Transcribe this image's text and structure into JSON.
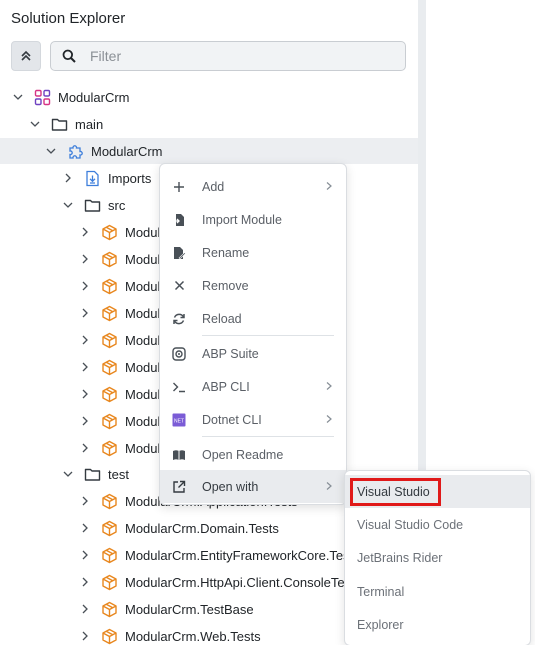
{
  "panel": {
    "title": "Solution Explorer"
  },
  "filter": {
    "placeholder": "Filter"
  },
  "tree": {
    "root": "ModularCrm",
    "main": "main",
    "module": "ModularCrm",
    "imports": "Imports",
    "src": "src",
    "src_items": [
      "Modular",
      "Modular",
      "Modular",
      "Modular",
      "Modular",
      "Modular",
      "Modular",
      "Modular",
      "Modular"
    ],
    "test": "test",
    "test_items": [
      "ModularCrm.Application.Tests",
      "ModularCrm.Domain.Tests",
      "ModularCrm.EntityFrameworkCore.Tests",
      "ModularCrm.HttpApi.Client.ConsoleTestApp",
      "ModularCrm.TestBase",
      "ModularCrm.Web.Tests"
    ]
  },
  "context_menu": {
    "items": [
      {
        "label": "Add",
        "icon": "plus-icon"
      },
      {
        "label": "Import Module",
        "icon": "import-icon"
      },
      {
        "label": "Rename",
        "icon": "rename-icon"
      },
      {
        "label": "Remove",
        "icon": "close-icon"
      },
      {
        "label": "Reload",
        "icon": "reload-icon"
      },
      {
        "label": "ABP Suite",
        "icon": "abp-suite-icon"
      },
      {
        "label": "ABP CLI",
        "icon": "terminal-icon"
      },
      {
        "label": "Dotnet CLI",
        "icon": "dotnet-icon"
      },
      {
        "label": "Open Readme",
        "icon": "book-icon"
      },
      {
        "label": "Open with",
        "icon": "external-link-icon"
      }
    ]
  },
  "open_with_menu": {
    "items": [
      "Visual Studio",
      "Visual Studio Code",
      "JetBrains Rider",
      "Terminal",
      "Explorer"
    ]
  },
  "colors": {
    "accent_orange": "#e8871e",
    "highlight_red": "#e01919",
    "dotnet_purple": "#7b5cd6",
    "root_icon": "#d63384"
  }
}
